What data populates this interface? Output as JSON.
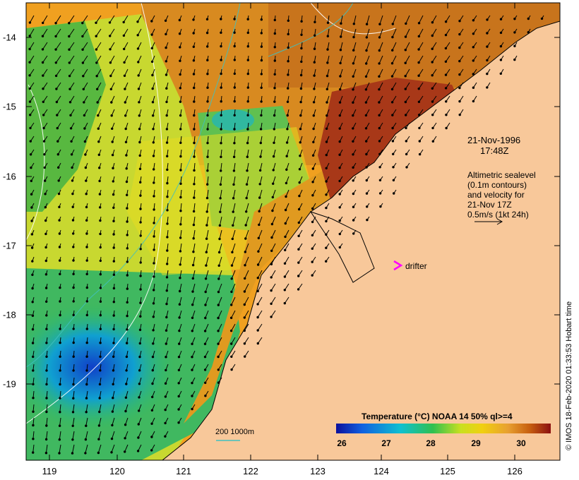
{
  "map": {
    "datetime_line1": "21-Nov-1996",
    "datetime_line2": "17:48Z",
    "description_lines": [
      "Altimetric sealevel",
      "(0.1m contours)",
      "and velocity for",
      "21-Nov 17Z",
      "0.5m/s (1kt 24h)"
    ],
    "drifter_label": "drifter",
    "drifter_color": "#ff00ff",
    "credit": "© IMOS 18-Feb-2020 01:33:53 Hobart time",
    "depth_label": "200  1000m",
    "depth_color": "#40c0c0",
    "land_color": "#f8c89a",
    "lat_ticks": [
      "-14",
      "-15",
      "-16",
      "-17",
      "-18",
      "-19"
    ],
    "lon_ticks": [
      "119",
      "120",
      "121",
      "122",
      "123",
      "124",
      "125",
      "126"
    ]
  },
  "colorbar": {
    "title": "Temperature (°C) NOAA 14 50% ql>=4",
    "ticks": [
      "26",
      "27",
      "28",
      "29",
      "30"
    ],
    "stops": [
      "#0c109c",
      "#1060e0",
      "#10c0d0",
      "#30c050",
      "#c8e020",
      "#f0d010",
      "#e8a030",
      "#c86010",
      "#8b1010"
    ]
  }
}
